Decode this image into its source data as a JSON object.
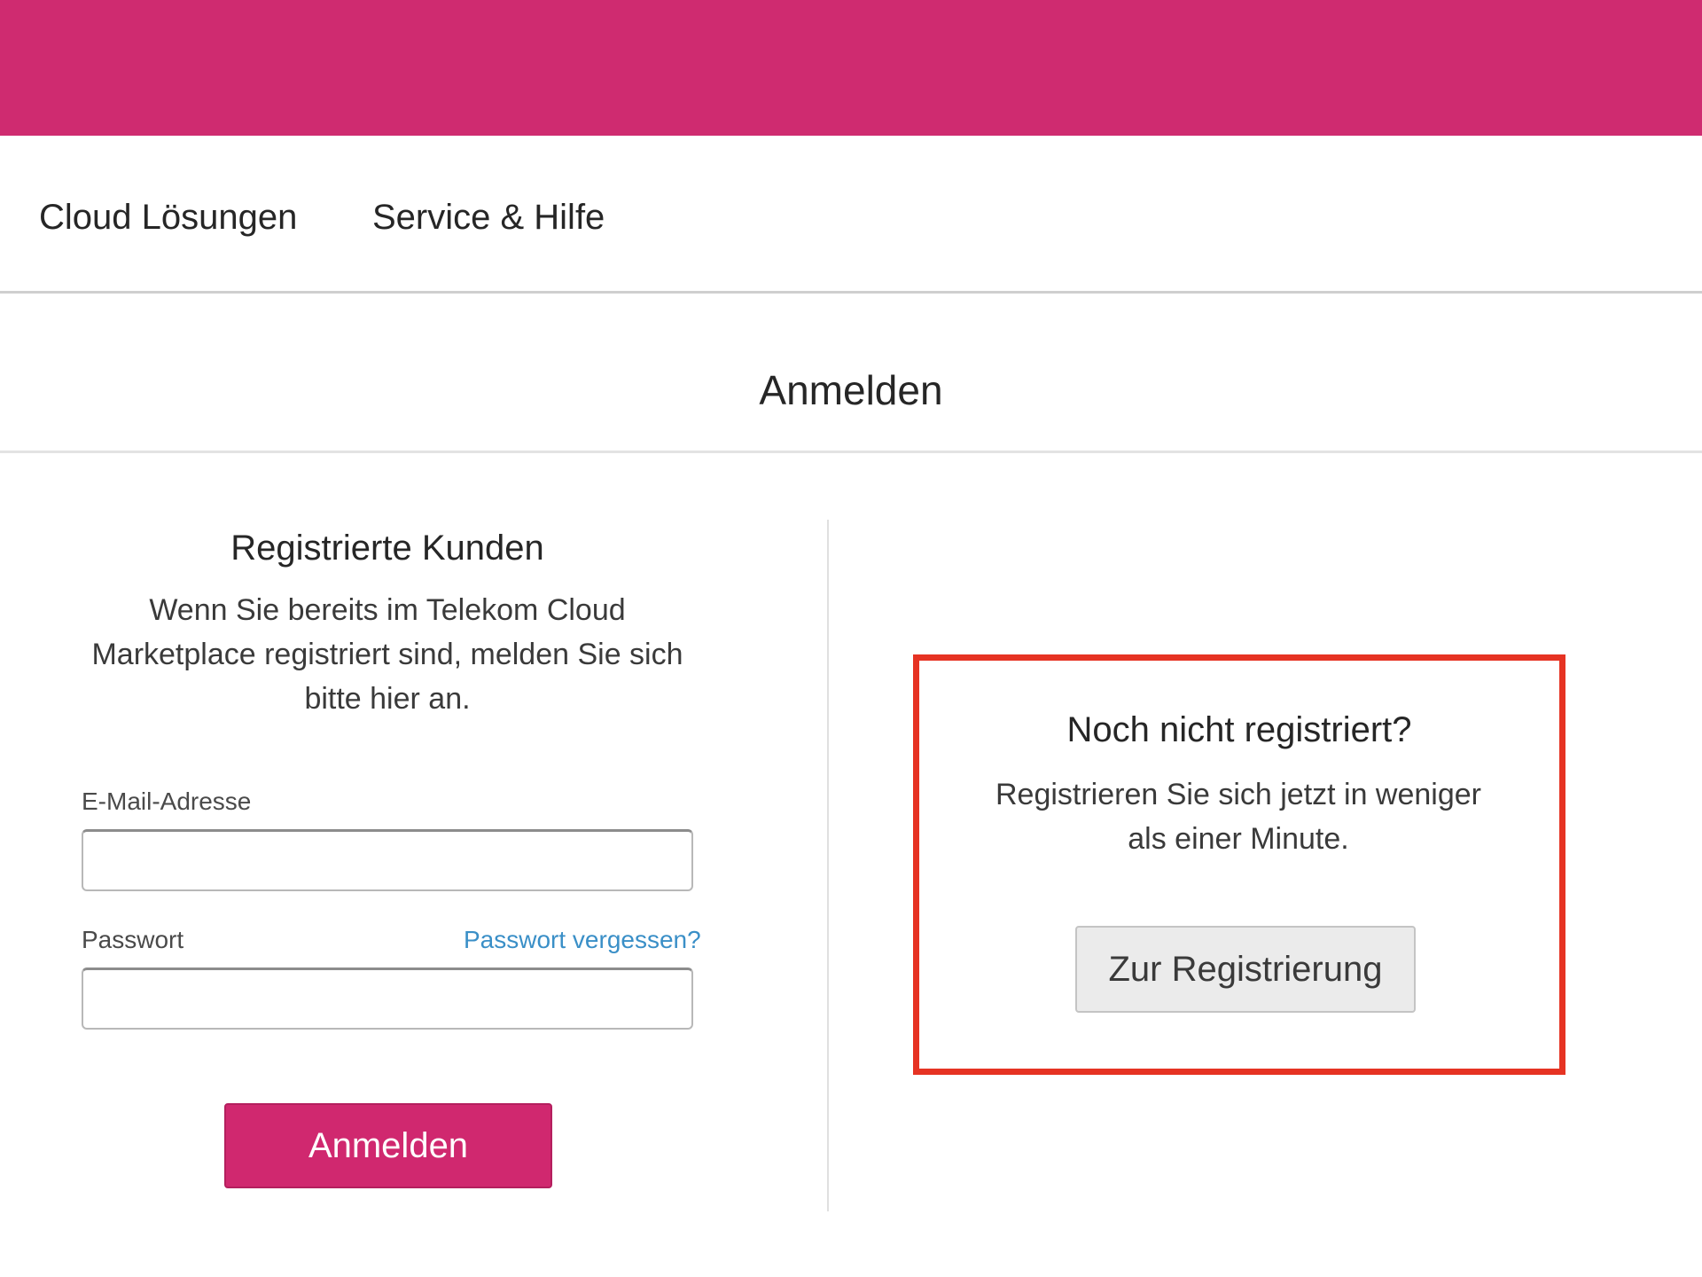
{
  "header": {
    "brand_color": "#cf2b70"
  },
  "nav": {
    "items": [
      {
        "label": "Cloud Lösungen"
      },
      {
        "label": "Service & Hilfe"
      }
    ]
  },
  "page": {
    "title": "Anmelden"
  },
  "login": {
    "title": "Registrierte Kunden",
    "description": "Wenn Sie bereits im Telekom Cloud Marketplace registriert sind, melden Sie sich bitte hier an.",
    "email_label": "E-Mail-Adresse",
    "email_value": "",
    "password_label": "Passwort",
    "password_value": "",
    "forgot_password": "Passwort vergessen?",
    "submit_label": "Anmelden"
  },
  "register": {
    "title": "Noch nicht registriert?",
    "description": "Registrieren Sie sich jetzt in weniger als einer Minute.",
    "button_label": "Zur Registrierung",
    "highlight_color": "#e63323"
  }
}
